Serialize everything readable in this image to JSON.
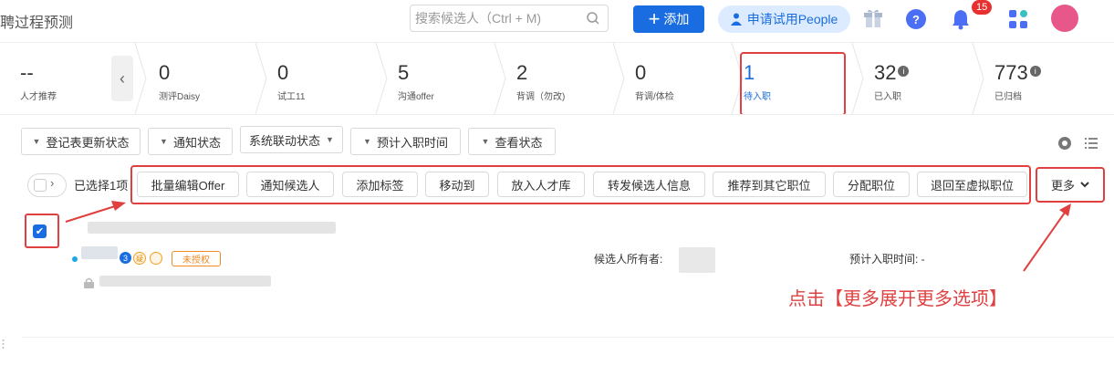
{
  "header": {
    "title": "聘过程预测",
    "search_placeholder": "搜索候选人（Ctrl + M)",
    "add_label": "添加",
    "trial_label": "申请试用People",
    "notification_count": "15",
    "help_label": "?"
  },
  "stages": [
    {
      "count": "--",
      "label": "人才推荐"
    },
    {
      "count": "0",
      "label": "测评Daisy"
    },
    {
      "count": "0",
      "label": "试工11"
    },
    {
      "count": "5",
      "label": "沟通offer"
    },
    {
      "count": "2",
      "label": "背调（勿改)"
    },
    {
      "count": "0",
      "label": "背调/体检"
    },
    {
      "count": "1",
      "label": "待入职",
      "active": true
    },
    {
      "count": "32",
      "label": "已入职",
      "info": true
    },
    {
      "count": "773",
      "label": "已归档",
      "info": true
    }
  ],
  "filters": [
    "登记表更新状态",
    "通知状态",
    "系统联动状态",
    "预计入职时间",
    "查看状态"
  ],
  "bulk": {
    "selected_text": "已选择1项",
    "actions": [
      "批量编辑Offer",
      "通知候选人",
      "添加标签",
      "移动到",
      "放入人才库",
      "转发候选人信息",
      "推荐到其它职位",
      "分配职位",
      "退回至虚拟职位"
    ],
    "more_label": "更多"
  },
  "candidate": {
    "count_badge": "3",
    "doubt_badge": "疑",
    "unauth_tag": "未授权",
    "owner_label": "候选人所有者:",
    "hire_time_label": "预计入职时间: -"
  },
  "annotation": "点击【更多展开更多选项】",
  "colors": {
    "primary": "#1a6de0",
    "annotation": "#e04040",
    "tag_orange": "#f08a24"
  }
}
